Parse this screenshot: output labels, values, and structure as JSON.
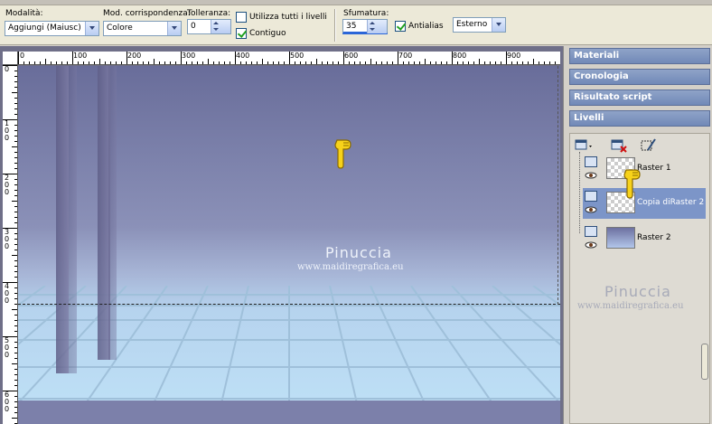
{
  "toolbar": {
    "mode_label": "Modalità:",
    "mode_value": "Aggiungi (Maiusc)",
    "match_label": "Mod. corrispondenza:",
    "match_value": "Colore",
    "tolerance_label": "Tolleranza:",
    "tolerance_value": "0",
    "use_all_layers_label": "Utilizza tutti i livelli",
    "use_all_layers_checked": false,
    "contiguous_label": "Contiguo",
    "contiguous_checked": true,
    "feather_label": "Sfumatura:",
    "feather_value": "35",
    "antialias_label": "Antialias",
    "antialias_checked": true,
    "position_value": "Esterno"
  },
  "rulers": {
    "horizontal_ticks": [
      "0",
      "100",
      "200",
      "300",
      "400",
      "500",
      "600",
      "700",
      "800",
      "900"
    ],
    "vertical_ticks": [
      "0",
      "1 0 0",
      "2 0 0",
      "3 0 0",
      "4 0 0",
      "5 0 0",
      "6 0 0"
    ]
  },
  "canvas": {
    "watermark_title": "Pinuccia",
    "watermark_url": "www.maidiregrafica.eu"
  },
  "panels": {
    "materials": "Materiali",
    "history": "Cronologia",
    "script_output": "Risultato script",
    "layers": "Livelli"
  },
  "layers": [
    {
      "name": "Raster 1",
      "selected": false,
      "thumb": "transparent"
    },
    {
      "name": "Copia diRaster 2",
      "selected": true,
      "thumb": "transparent"
    },
    {
      "name": "Raster 2",
      "selected": false,
      "thumb": "gradient"
    }
  ],
  "layers_watermark": {
    "title": "Pinuccia",
    "url": "www.maidiregrafica.eu"
  },
  "colors": {
    "panel_header": "#7c8fbd",
    "selected_layer": "#7c95c8",
    "check_green": "#21a121"
  },
  "icons": [
    "new-layer-icon",
    "delete-layer-icon",
    "edit-selection-icon",
    "pointing-hand-icon",
    "eye-icon"
  ]
}
